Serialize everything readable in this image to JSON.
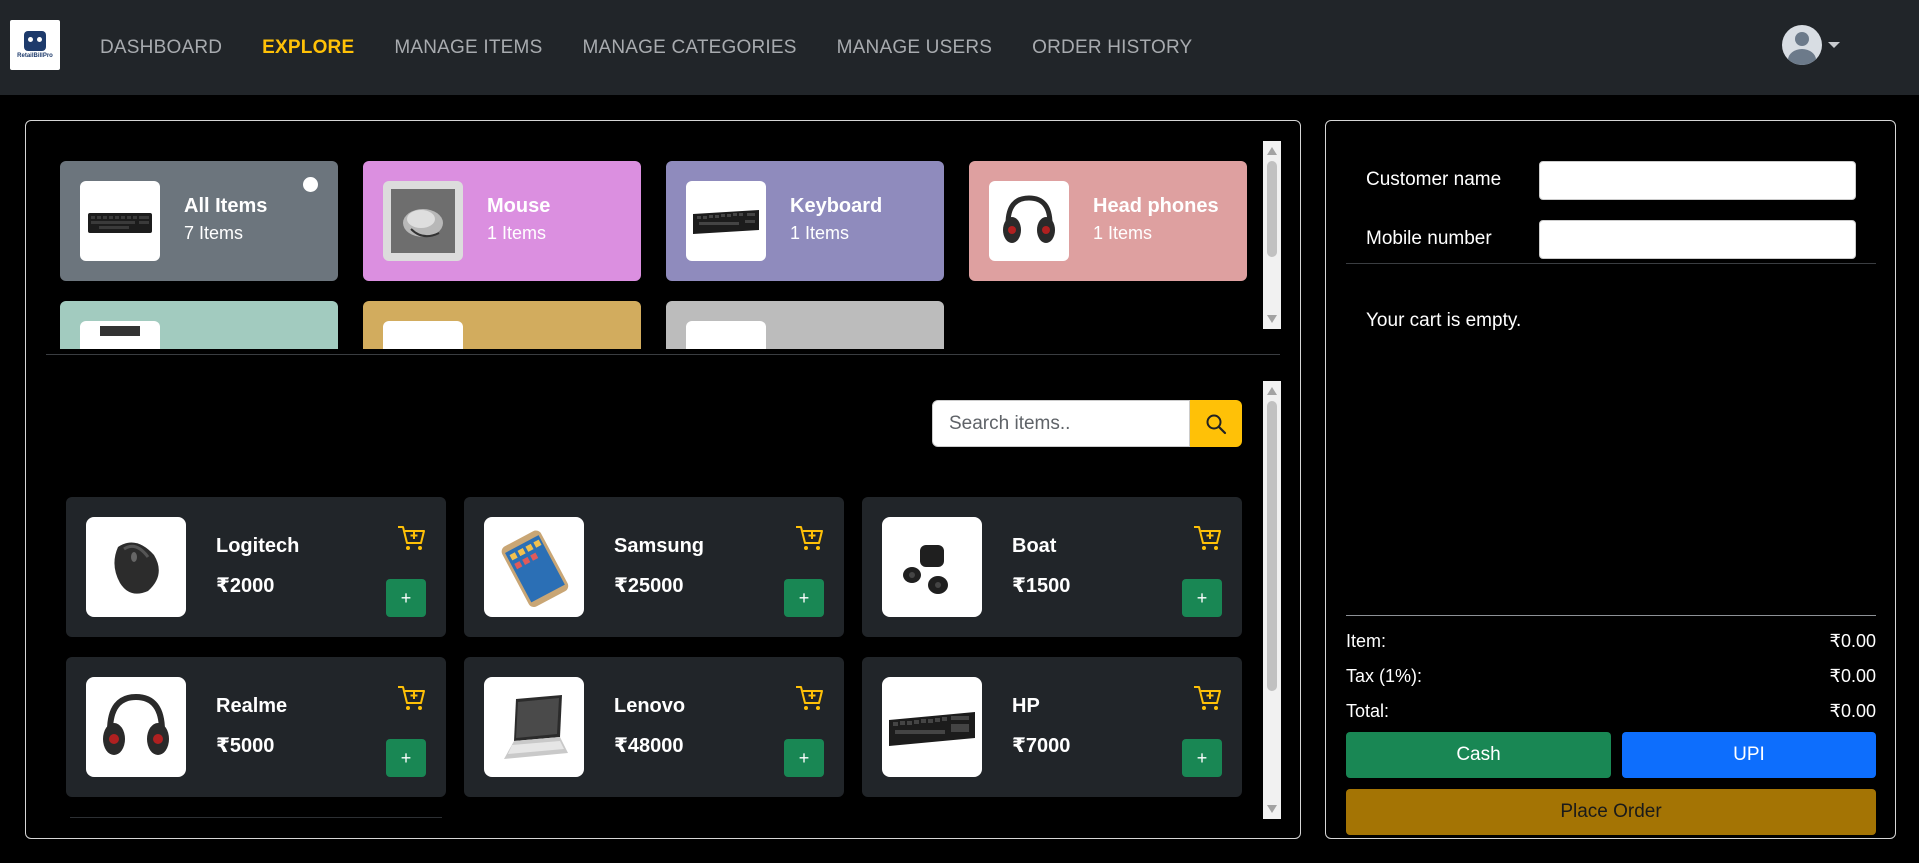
{
  "app": {
    "logo_text": "RetailBillPro"
  },
  "nav": {
    "items": [
      {
        "label": "DASHBOARD"
      },
      {
        "label": "EXPLORE"
      },
      {
        "label": "MANAGE ITEMS"
      },
      {
        "label": "MANAGE CATEGORIES"
      },
      {
        "label": "MANAGE USERS"
      },
      {
        "label": "ORDER HISTORY"
      }
    ],
    "active": "EXPLORE"
  },
  "categories": [
    {
      "name": "All Items",
      "count": "7 Items",
      "color": "#6c757d",
      "icon": "keyboard-icon",
      "selected": true
    },
    {
      "name": "Mouse",
      "count": "1 Items",
      "color": "#db8fe0",
      "icon": "mouse-icon"
    },
    {
      "name": "Keyboard",
      "count": "1 Items",
      "color": "#8f8bbd",
      "icon": "keyboard-icon"
    },
    {
      "name": "Head phones",
      "count": "1 Items",
      "color": "#dea0a0",
      "icon": "headphones-icon"
    },
    {
      "name": "",
      "count": "",
      "color": "#a2cbbf",
      "icon": "laptop-icon"
    },
    {
      "name": "",
      "count": "",
      "color": "#d2ac5e",
      "icon": "phone-icon"
    },
    {
      "name": "",
      "count": "",
      "color": "#bcbcbc",
      "icon": "earbuds-icon"
    }
  ],
  "search": {
    "placeholder": "Search items.."
  },
  "items": [
    {
      "name": "Logitech",
      "price": "₹2000",
      "icon": "mouse-icon"
    },
    {
      "name": "Samsung",
      "price": "₹25000",
      "icon": "phone-icon"
    },
    {
      "name": "Boat",
      "price": "₹1500",
      "icon": "earbuds-icon"
    },
    {
      "name": "Realme",
      "price": "₹5000",
      "icon": "headphones-icon"
    },
    {
      "name": "Lenovo",
      "price": "₹48000",
      "icon": "laptop-icon"
    },
    {
      "name": "HP",
      "price": "₹7000",
      "icon": "keyboard-icon"
    }
  ],
  "add_label": "+",
  "customer": {
    "name_label": "Customer name",
    "mobile_label": "Mobile number",
    "name_value": "",
    "mobile_value": ""
  },
  "cart": {
    "empty_text": "Your cart is empty."
  },
  "summary": {
    "item_label": "Item:",
    "item_value": "₹0.00",
    "tax_label": "Tax (1%):",
    "tax_value": "₹0.00",
    "total_label": "Total:",
    "total_value": "₹0.00"
  },
  "payment": {
    "cash_label": "Cash",
    "upi_label": "UPI",
    "place_order_label": "Place Order"
  },
  "colors": {
    "accent": "#ffc107",
    "nav_bg": "#212529",
    "card_bg": "#212529",
    "success": "#198754",
    "primary": "#0d6efd",
    "warning_dark": "#a47404"
  }
}
